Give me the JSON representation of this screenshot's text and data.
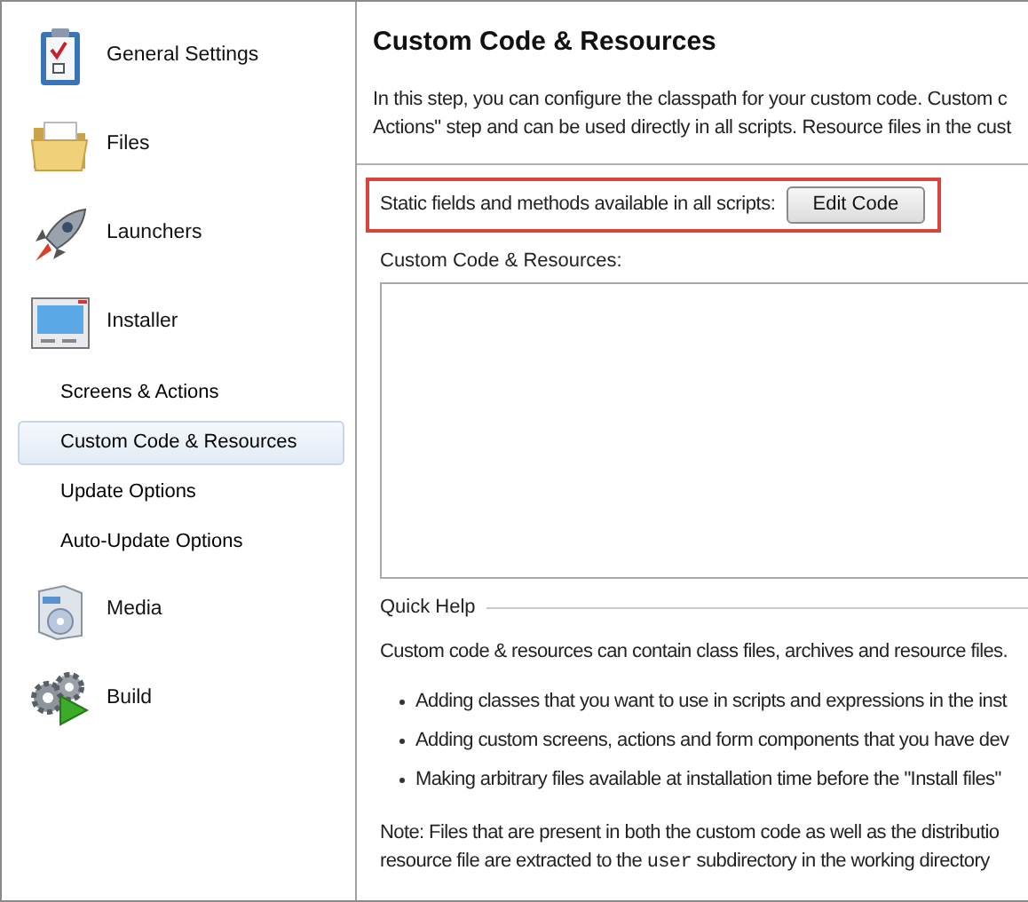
{
  "sidebar": {
    "items": [
      {
        "kind": "section",
        "label": "General Settings",
        "selected": false
      },
      {
        "kind": "section",
        "label": "Files",
        "selected": false
      },
      {
        "kind": "section",
        "label": "Launchers",
        "selected": false
      },
      {
        "kind": "section",
        "label": "Installer",
        "selected": false
      },
      {
        "kind": "page",
        "label": "Screens & Actions",
        "selected": false
      },
      {
        "kind": "page",
        "label": "Custom Code & Resources",
        "selected": true
      },
      {
        "kind": "page",
        "label": "Update Options",
        "selected": false
      },
      {
        "kind": "page",
        "label": "Auto-Update Options",
        "selected": false
      },
      {
        "kind": "section",
        "label": "Media",
        "selected": false
      },
      {
        "kind": "section",
        "label": "Build",
        "selected": false
      }
    ]
  },
  "content": {
    "title": "Custom Code & Resources",
    "intro": [
      "In this step, you can configure the classpath for your custom code. Custom c",
      "Actions\" step and can be used directly in all scripts. Resource files in the cust"
    ],
    "static_fields": {
      "label": "Static fields and methods available in all scripts:",
      "button": "Edit Code",
      "highlighted": true
    },
    "list_label": "Custom Code & Resources:",
    "quick_help": {
      "title": "Quick Help",
      "text": "Custom code & resources can contain class files, archives and resource files.",
      "bullets": [
        "Adding classes that you want to use in scripts and expressions in the inst",
        "Adding custom screens, actions and form components that you have dev",
        "Making arbitrary files available at installation time before the \"Install files\""
      ],
      "note": [
        "Note: Files that are present in both the custom code as well as the distributio",
        [
          "resource file are extracted to the ",
          "user",
          " subdirectory in the working directory"
        ]
      ]
    }
  }
}
